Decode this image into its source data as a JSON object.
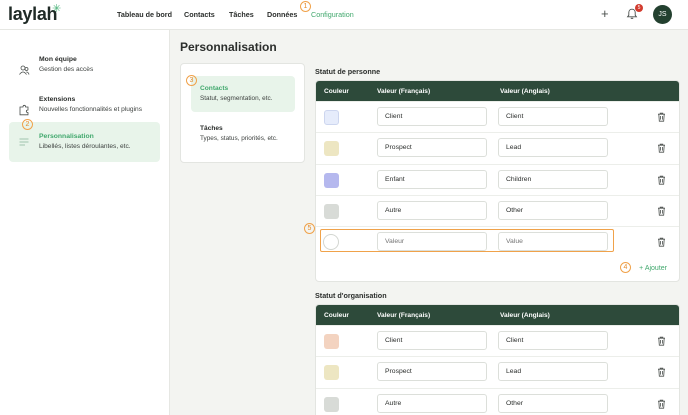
{
  "app": {
    "logo": "laylah"
  },
  "nav": [
    {
      "label": "Tableau de bord"
    },
    {
      "label": "Contacts"
    },
    {
      "label": "Tâches"
    },
    {
      "label": "Données"
    },
    {
      "label": "Configuration"
    }
  ],
  "header": {
    "notification_count": "5",
    "avatar_initials": "JS"
  },
  "markers": [
    "1",
    "2",
    "3",
    "4",
    "5"
  ],
  "sidebar": {
    "items": [
      {
        "title": "Mon équipe",
        "subtitle": "Gestion des accès",
        "icon": "team-icon"
      },
      {
        "title": "Extensions",
        "subtitle": "Nouvelles fonctionnalités et plugins",
        "icon": "puzzle-icon"
      },
      {
        "title": "Personnalisation",
        "subtitle": "Libellés, listes déroulantes, etc.",
        "icon": "sliders-icon"
      }
    ]
  },
  "page": {
    "title": "Personnalisation"
  },
  "subnav": [
    {
      "title": "Contacts",
      "subtitle": "Statut, segmentation, etc."
    },
    {
      "title": "Tâches",
      "subtitle": "Types, status, priorités, etc."
    }
  ],
  "person_status": {
    "title": "Statut de personne",
    "headers": {
      "color": "Couleur",
      "fr": "Valeur (Français)",
      "en": "Valeur (Anglais)"
    },
    "rows": [
      {
        "color": "#e6ecfb",
        "fr": "Client",
        "en": "Client"
      },
      {
        "color": "#ede6c2",
        "fr": "Prospect",
        "en": "Lead"
      },
      {
        "color": "#b5b8ee",
        "fr": "Enfant",
        "en": "Children"
      },
      {
        "color": "#d8dbd7",
        "fr": "Autre",
        "en": "Other"
      }
    ],
    "new_row": {
      "fr_placeholder": "Valeur",
      "en_placeholder": "Value"
    },
    "add_label": "Ajouter"
  },
  "org_status": {
    "title": "Statut d'organisation",
    "headers": {
      "color": "Couleur",
      "fr": "Valeur (Français)",
      "en": "Valeur (Anglais)"
    },
    "rows": [
      {
        "color": "#f3d3c0",
        "fr": "Client",
        "en": "Client"
      },
      {
        "color": "#ede6c2",
        "fr": "Prospect",
        "en": "Lead"
      },
      {
        "color": "#d8dbd7",
        "fr": "Autre",
        "en": "Other"
      }
    ]
  },
  "colors": {
    "accent": "#41a86d",
    "header_dark": "#2d4a3a",
    "marker": "#f0a24a"
  }
}
